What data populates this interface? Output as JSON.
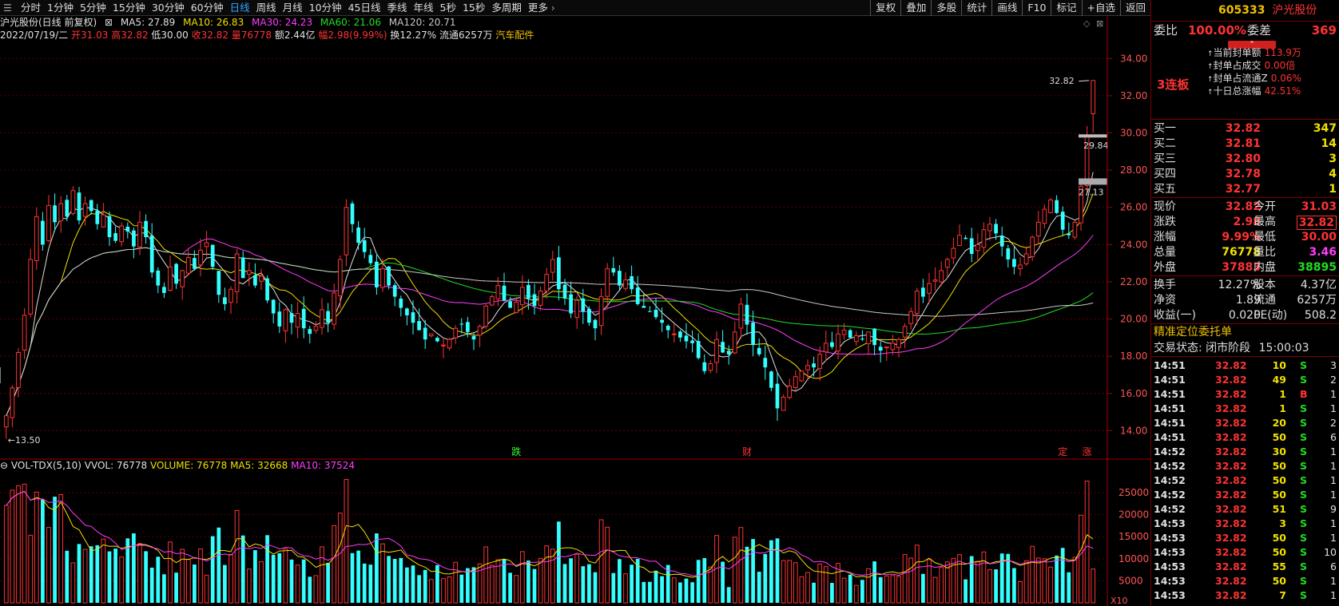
{
  "toolbar": {
    "periods": [
      "分时",
      "1分钟",
      "5分钟",
      "15分钟",
      "30分钟",
      "60分钟",
      "日线",
      "周线",
      "月线",
      "10分钟",
      "45日线",
      "季线",
      "年线",
      "5秒",
      "15秒",
      "多周期",
      "更多"
    ],
    "active_period": "日线",
    "right_buttons": [
      "复权",
      "叠加",
      "多股",
      "统计",
      "画线",
      "F10",
      "标记",
      "+自选",
      "返回"
    ]
  },
  "info": {
    "title": "沪光股份(日线 前复权)",
    "ma5": "MA5: 27.89",
    "ma10": "MA10: 26.83",
    "ma30": "MA30: 24.23",
    "ma60": "MA60: 21.06",
    "ma120": "MA120: 20.71",
    "date": "2022/07/19/二",
    "open": "开31.03",
    "high": "高32.82",
    "low": "低30.00",
    "close": "收32.82",
    "vol": "量76778",
    "amount": "额2.44亿",
    "change": "幅2.98(9.99%)",
    "turnover": "换12.27%",
    "float": "流通6257万",
    "sector": "汽车配件"
  },
  "vol_info": {
    "name": "VOL-TDX(5,10)",
    "vvol": "VVOL: 76778",
    "volume": "VOLUME: 76778",
    "ma5": "MA5: 32668",
    "ma10": "MA10: 37524"
  },
  "price_axis": [
    "34.00",
    "32.00",
    "30.00",
    "28.00",
    "26.00",
    "24.00",
    "22.00",
    "20.00",
    "18.00",
    "16.00",
    "14.00"
  ],
  "vol_axis": [
    "25000",
    "20000",
    "15000",
    "10000",
    "5000"
  ],
  "vol_unit": "X10",
  "annotations": {
    "high_label": "32.82",
    "low_label": "13.50",
    "level1": "29.84",
    "level2": "27.13",
    "event_die": "跌",
    "event_cai": "财",
    "event_ding": "定",
    "event_zhang": "涨"
  },
  "colors": {
    "up": "#ff3333",
    "down": "#33ffff",
    "ma5": "#e0e0e0",
    "ma10": "#f0e000",
    "ma30": "#ff3cff",
    "ma60": "#22dd22",
    "ma120": "#c8c8c8"
  },
  "chart_data": {
    "type": "candlestick",
    "price_range": [
      12.9,
      35.0
    ],
    "volume_range": [
      0,
      29000
    ],
    "last_candle": {
      "date": "2022/07/19",
      "open": 31.03,
      "high": 32.82,
      "low": 30.0,
      "close": 32.82,
      "volume": 76778
    },
    "ma_last": {
      "MA5": 27.89,
      "MA10": 26.83,
      "MA30": 24.23,
      "MA60": 21.06,
      "MA120": 20.71
    },
    "volume_ma_last": {
      "MA5": 32668,
      "MA10": 37524
    },
    "extremes": {
      "high": 32.82,
      "low": 13.5
    },
    "closes": [
      14.8,
      16.3,
      18.2,
      20.2,
      23.2,
      25.5,
      24.0,
      26.1,
      25.2,
      26.2,
      25.5,
      26.9,
      25.3,
      26.2,
      25.8,
      25.1,
      25.6,
      24.4,
      24.2,
      25.0,
      24.7,
      23.9,
      25.2,
      24.4,
      22.5,
      21.8,
      21.4,
      22.8,
      21.9,
      22.6,
      23.3,
      22.7,
      23.7,
      24.1,
      22.8,
      21.3,
      20.8,
      21.6,
      23.5,
      22.2,
      22.6,
      21.8,
      22.3,
      21.0,
      20.3,
      19.6,
      20.5,
      19.8,
      20.3,
      19.5,
      19.2,
      19.6,
      20.5,
      19.8,
      21.4,
      23.2,
      26.0,
      25.1,
      24.1,
      23.6,
      23.0,
      21.7,
      22.7,
      21.8,
      21.2,
      20.6,
      20.2,
      19.8,
      19.4,
      18.9,
      19.2,
      18.8,
      18.6,
      18.9,
      19.5,
      19.7,
      19.3,
      18.9,
      19.6,
      20.7,
      21.2,
      21.8,
      21.0,
      20.6,
      20.9,
      21.7,
      21.1,
      20.7,
      21.5,
      22.4,
      23.2,
      21.6,
      21.1,
      20.3,
      21.0,
      20.4,
      19.8,
      19.5,
      21.2,
      22.7,
      22.5,
      21.8,
      22.1,
      21.6,
      20.8,
      20.6,
      20.4,
      20.1,
      19.8,
      19.4,
      19.2,
      19.0,
      18.8,
      18.7,
      17.9,
      17.2,
      17.6,
      18.9,
      18.2,
      18.1,
      19.3,
      20.8,
      19.7,
      18.6,
      18.1,
      17.4,
      16.3,
      15.2,
      15.8,
      16.4,
      16.9,
      17.2,
      17.5,
      17.4,
      18.1,
      18.7,
      18.5,
      19.2,
      19.4,
      19.0,
      19.1,
      18.9,
      19.3,
      18.6,
      18.3,
      18.5,
      18.7,
      18.9,
      19.6,
      20.4,
      21.5,
      21.2,
      21.9,
      22.1,
      22.6,
      23.2,
      23.8,
      24.5,
      24.3,
      23.5,
      24.0,
      24.8,
      25.1,
      24.6,
      23.9,
      23.2,
      22.8,
      22.9,
      23.5,
      24.4,
      25.2,
      25.9,
      26.4,
      25.7,
      24.8,
      24.5,
      25.2,
      27.13,
      29.84,
      32.82
    ]
  },
  "side": {
    "code": "605333",
    "name": "沪光股份",
    "ratio_label": "委比",
    "ratio_value": "100.00%",
    "diff_label": "委差",
    "diff_value": "369",
    "boards": "3连板",
    "seal": [
      {
        "label": "当前封单额",
        "value": "113.9万"
      },
      {
        "label": "封单占成交",
        "value": "0.00倍"
      },
      {
        "label": "封单占流通Z",
        "value": "0.06%"
      },
      {
        "label": "十日总涨幅",
        "value": "42.51%"
      }
    ],
    "bids": [
      {
        "label": "买一",
        "price": "32.82",
        "vol": "347"
      },
      {
        "label": "买二",
        "price": "32.81",
        "vol": "14"
      },
      {
        "label": "买三",
        "price": "32.80",
        "vol": "3"
      },
      {
        "label": "买四",
        "price": "32.78",
        "vol": "4"
      },
      {
        "label": "买五",
        "price": "32.77",
        "vol": "1"
      }
    ],
    "stats1": [
      {
        "l1": "现价",
        "v1": "32.82",
        "l2": "今开",
        "v2": "31.03"
      },
      {
        "l1": "涨跌",
        "v1": "2.98",
        "l2": "最高",
        "v2": "32.82"
      },
      {
        "l1": "涨幅",
        "v1": "9.99%",
        "l2": "最低",
        "v2": "30.00"
      },
      {
        "l1": "总量",
        "v1": "76778",
        "l2": "量比",
        "v2": "3.46"
      },
      {
        "l1": "外盘",
        "v1": "37883",
        "l2": "内盘",
        "v2": "38895"
      }
    ],
    "stats2": [
      {
        "l1": "换手",
        "v1": "12.27%",
        "l2": "股本",
        "v2": "4.37亿"
      },
      {
        "l1": "净资",
        "v1": "1.89",
        "l2": "流通",
        "v2": "6257万"
      },
      {
        "l1": "收益(一)",
        "v1": "0.020",
        "l2": "PE(动)",
        "v2": "508.2"
      }
    ],
    "order_title": "精准定位委托单",
    "trade_state_label": "交易状态:",
    "trade_state": "闭市阶段",
    "trade_time": "15:00:03",
    "ticks": [
      {
        "t": "14:51",
        "p": "32.82",
        "v": "10",
        "s": "S",
        "n": "3"
      },
      {
        "t": "14:51",
        "p": "32.82",
        "v": "49",
        "s": "S",
        "n": "2"
      },
      {
        "t": "14:51",
        "p": "32.82",
        "v": "1",
        "s": "B",
        "n": "1"
      },
      {
        "t": "14:51",
        "p": "32.82",
        "v": "1",
        "s": "S",
        "n": "1"
      },
      {
        "t": "14:51",
        "p": "32.82",
        "v": "20",
        "s": "S",
        "n": "2"
      },
      {
        "t": "14:51",
        "p": "32.82",
        "v": "50",
        "s": "S",
        "n": "6"
      },
      {
        "t": "14:52",
        "p": "32.82",
        "v": "30",
        "s": "S",
        "n": "1"
      },
      {
        "t": "14:52",
        "p": "32.82",
        "v": "50",
        "s": "S",
        "n": "1"
      },
      {
        "t": "14:52",
        "p": "32.82",
        "v": "50",
        "s": "S",
        "n": "1"
      },
      {
        "t": "14:52",
        "p": "32.82",
        "v": "50",
        "s": "S",
        "n": "1"
      },
      {
        "t": "14:52",
        "p": "32.82",
        "v": "51",
        "s": "S",
        "n": "9"
      },
      {
        "t": "14:53",
        "p": "32.82",
        "v": "3",
        "s": "S",
        "n": "1"
      },
      {
        "t": "14:53",
        "p": "32.82",
        "v": "50",
        "s": "S",
        "n": "1"
      },
      {
        "t": "14:53",
        "p": "32.82",
        "v": "50",
        "s": "S",
        "n": "10"
      },
      {
        "t": "14:53",
        "p": "32.82",
        "v": "55",
        "s": "S",
        "n": "6"
      },
      {
        "t": "14:53",
        "p": "32.82",
        "v": "50",
        "s": "S",
        "n": "1"
      },
      {
        "t": "14:53",
        "p": "32.82",
        "v": "7",
        "s": "S",
        "n": "1"
      },
      {
        "t": "14:53",
        "p": "32.82",
        "v": "1",
        "s": "S",
        "n": "1"
      }
    ]
  }
}
